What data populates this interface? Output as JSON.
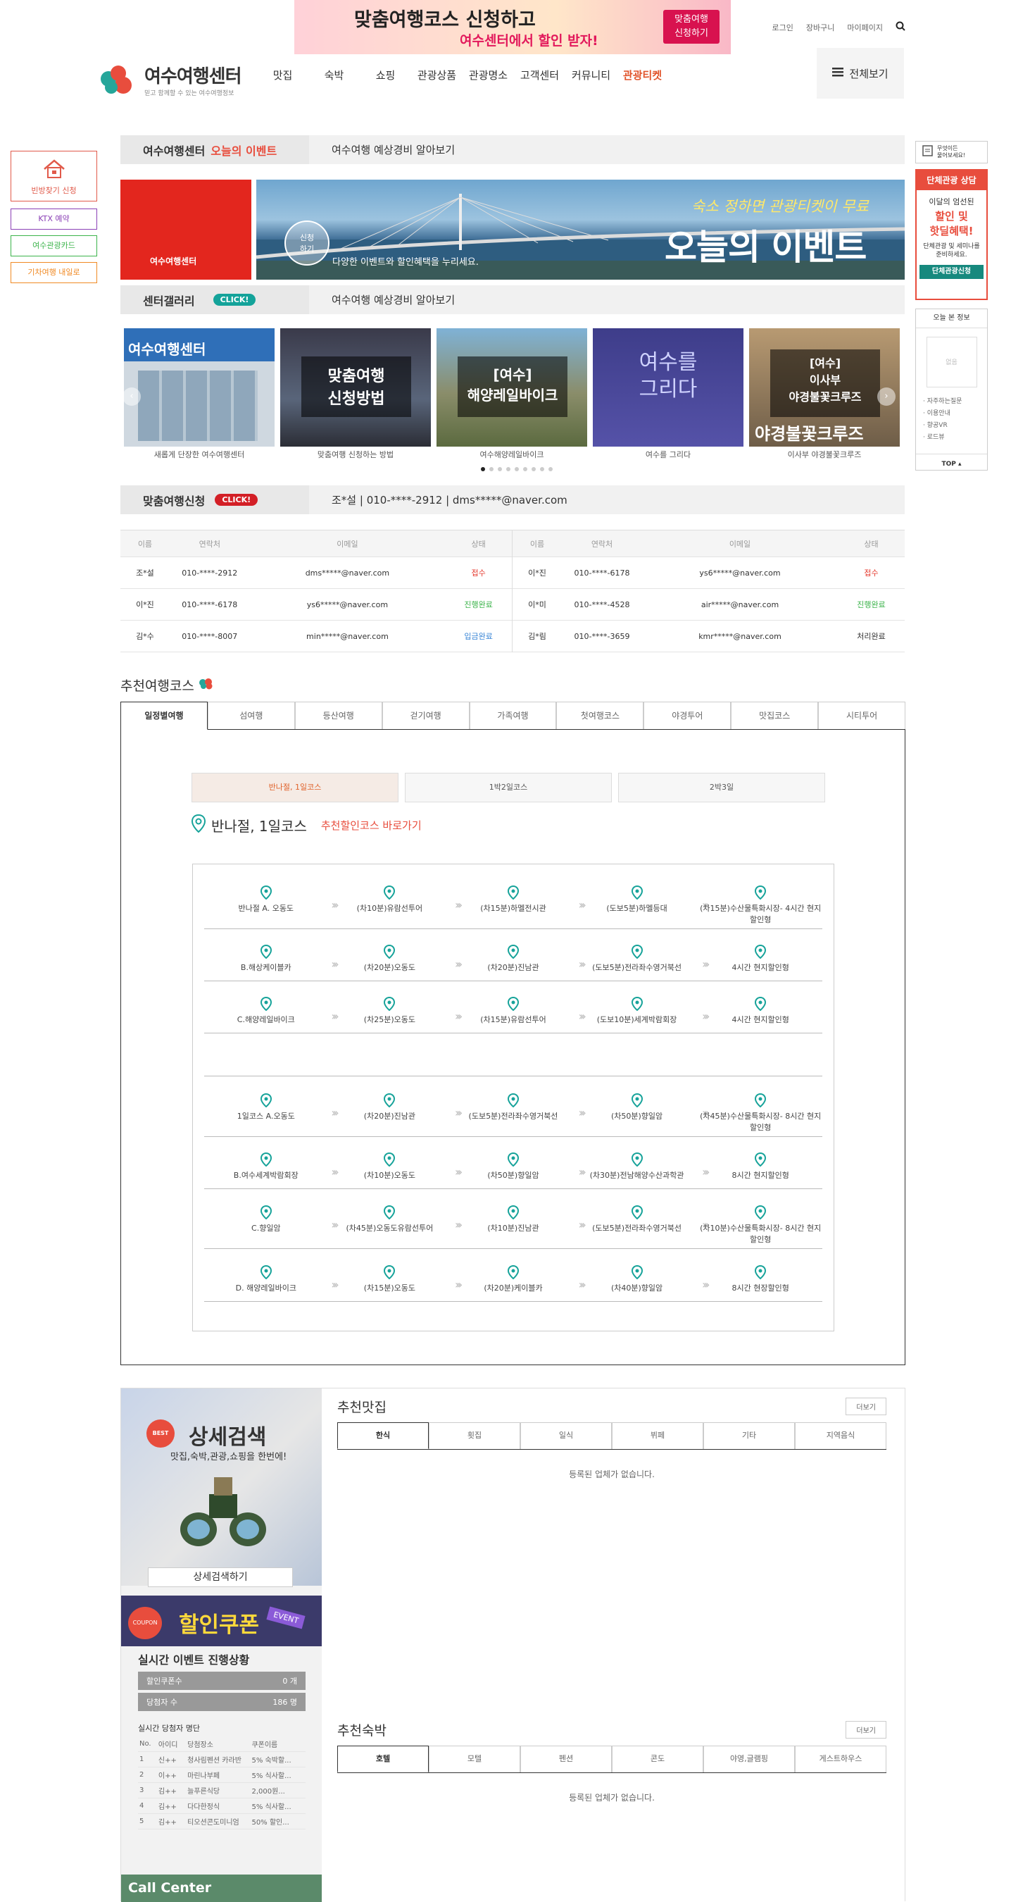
{
  "top": {
    "banner_line1": "맞춤여행코스 신청하고",
    "banner_line2": "여수센터에서 할인 받자!",
    "banner_btn": "맞춤여행\n신청하기",
    "links": [
      "로그인",
      "장바구니",
      "마이페이지"
    ]
  },
  "logo": {
    "name": "여수여행센터",
    "sub": "믿고 함께할 수 있는 여수여행정보"
  },
  "gnb": [
    "맛집",
    "숙박",
    "쇼핑",
    "관광상품",
    "관광명소",
    "고객센터",
    "커뮤니티",
    "관광티켓"
  ],
  "all_menu": "전체보기",
  "left_quick": {
    "box": "빈방찾기 신청",
    "btns": [
      "KTX 예약",
      "여수관광카드",
      "기차여행 내일로"
    ]
  },
  "event": {
    "bar_label": "여수여행센터",
    "bar_highlight": "오늘의 이벤트",
    "bar_right": "여수여행 예상경비 알아보기",
    "main_title": "오늘의 이벤트",
    "main_top": "숙소 정하면 관광티켓이 무료",
    "main_caption": "다양한 이벤트와 할인혜택을 누리세요.",
    "circle": "신청\n하기",
    "logo_text": "여수여행센터"
  },
  "gallery": {
    "bar_label": "센터갤러리",
    "click": "CLICK!",
    "bar_right": "여수여행 예상경비 알아보기",
    "items": [
      {
        "overlay": "",
        "title": "여수여행센터",
        "caption": "새롭게 단장한 여수여행센터"
      },
      {
        "overlay": "맞춤여행\n신청방법",
        "title": "",
        "caption": "맞춤여행 신청하는 방법"
      },
      {
        "overlay": "[여수]\n해양레일바이크",
        "title": "",
        "caption": "여수해양레일바이크"
      },
      {
        "overlay": "여수를\n그리다",
        "title": "",
        "caption": "여수를 그리다"
      },
      {
        "overlay": "[여수]\n이사부\n야경불꽃크루즈",
        "title": "야경불꽃크루즈",
        "caption": "이사부 야경불꽃크루즈"
      }
    ]
  },
  "custom": {
    "bar_label": "맞춤여행신청",
    "click": "CLICK!",
    "bar_right": "조*설 | 010-****-2912 | dms*****@naver.com",
    "headers": [
      "이름",
      "연락처",
      "이메일",
      "상태"
    ],
    "left": [
      {
        "name": "조*설",
        "phone": "010-****-2912",
        "email": "dms*****@naver.com",
        "status": "접수",
        "color": "#e53b2f"
      },
      {
        "name": "이*진",
        "phone": "010-****-6178",
        "email": "ys6*****@naver.com",
        "status": "진행완료",
        "color": "#3bb34a"
      },
      {
        "name": "김*수",
        "phone": "010-****-8007",
        "email": "min*****@naver.com",
        "status": "입금완료",
        "color": "#3a86d6"
      }
    ],
    "right": [
      {
        "name": "이*진",
        "phone": "010-****-6178",
        "email": "ys6*****@naver.com",
        "status": "접수",
        "color": "#e53b2f"
      },
      {
        "name": "이*미",
        "phone": "010-****-4528",
        "email": "air*****@naver.com",
        "status": "진행완료",
        "color": "#3bb34a"
      },
      {
        "name": "김*림",
        "phone": "010-****-3659",
        "email": "kmr*****@naver.com",
        "status": "처리완료",
        "color": "#333333"
      }
    ]
  },
  "rec": {
    "title": "추천여행코스",
    "tabs": [
      "일정별여행",
      "섬여행",
      "등산여행",
      "걷기여행",
      "가족여행",
      "첫여행코스",
      "야경투어",
      "맛집코스",
      "시티투어"
    ],
    "course_btns": [
      "반나절, 1일코스",
      "1박2일코스",
      "2박3일"
    ],
    "course_title": "반나절, 1일코스",
    "course_link": "추천할인코스 바로가기",
    "rows": [
      [
        "반나절 A. 오동도",
        "(차10분)유람선투어",
        "(차15분)하멜전시관",
        "(도보5분)하멜등대",
        "(차15분)수산물특화시장- 4시간 현지할인형"
      ],
      [
        "B.해상케이블카",
        "(차20분)오동도",
        "(차20분)진남관",
        "(도보5분)전라좌수영거북선",
        "4시간 현지할인형"
      ],
      [
        "C.해양레일바이크",
        "(차25분)오동도",
        "(차15분)유람선투어",
        "(도보10분)세계박람회장",
        "4시간 현지할인형"
      ],
      [
        "1일코스 A.오동도",
        "(차20분)진남관",
        "(도보5분)전라좌수영거북선",
        "(차50분)향일암",
        "(차45분)수산물특화시장- 8시간 현지할인형"
      ],
      [
        "B.여수세계박람회장",
        "(차10분)오동도",
        "(차50분)향일암",
        "(차30분)전남해양수산과학관",
        "8시간 현지할인형"
      ],
      [
        "C.향일암",
        "(차45분)오동도유람선투어",
        "(차10분)진남관",
        "(도보5분)전라좌수영거북선",
        "(차10분)수산물특화시장- 8시간 현지할인형"
      ],
      [
        "D. 해양레일바이크",
        "(차15분)오동도",
        "(차20분)케이블카",
        "(차40분)향일암",
        "8시간 현장할인형"
      ]
    ]
  },
  "search": {
    "title": "상세검색",
    "sub": "맛집,숙박,관광,쇼핑을 한번에!",
    "btn": "상세검색하기",
    "best": "BEST"
  },
  "coupon": {
    "title": "할인쿠폰",
    "event": "EVENT",
    "coupon_tag": "COUPON",
    "live": "실시간 이벤트 진행상황",
    "c_label": "할인쿠폰수",
    "c_val": "0 개",
    "w_label": "당첨자 수",
    "w_val": "186 명",
    "list_title": "실시간 당첨자 명단",
    "headers": [
      "No.",
      "아이디",
      "당첨장소",
      "쿠폰이름"
    ],
    "rows": [
      [
        "1",
        "신++",
        "청사림펜션 카라반",
        "5% 숙박할..."
      ],
      [
        "2",
        "이++",
        "마린나부페",
        "5% 식사할..."
      ],
      [
        "3",
        "김++",
        "늘푸른식당",
        "2,000원..."
      ],
      [
        "4",
        "김++",
        "다다한정식",
        "5% 식사할..."
      ],
      [
        "5",
        "김++",
        "티오션콘도미니엄",
        "50% 할인..."
      ]
    ]
  },
  "call": "Call Center",
  "food": {
    "title": "추천맛집",
    "more": "더보기",
    "tabs": [
      "한식",
      "횟집",
      "일식",
      "뷔페",
      "기타",
      "지역음식"
    ],
    "empty": "등록된 업체가 없습니다."
  },
  "stay": {
    "title": "추천숙박",
    "more": "더보기",
    "tabs": [
      "호텔",
      "모텔",
      "펜션",
      "콘도",
      "야영,글램핑",
      "게스트하우스"
    ],
    "empty": "등록된 업체가 없습니다."
  },
  "right_quick": {
    "memo": "무엇이든\n물어보세요!",
    "group_title": "단체관광 상담",
    "group_l1": "이달의 엄선된",
    "group_l2": "할인 및",
    "group_l3": "핫딜혜택!",
    "group_l4": "단체관광 및 세미나를 준비하세요.",
    "group_btn": "단체관광신청",
    "today": "오늘 본 정보",
    "today_empty": "없음",
    "links": [
      "자주하는질문",
      "이용안내",
      "향공VR",
      "로드뷰"
    ],
    "top": "TOP"
  }
}
